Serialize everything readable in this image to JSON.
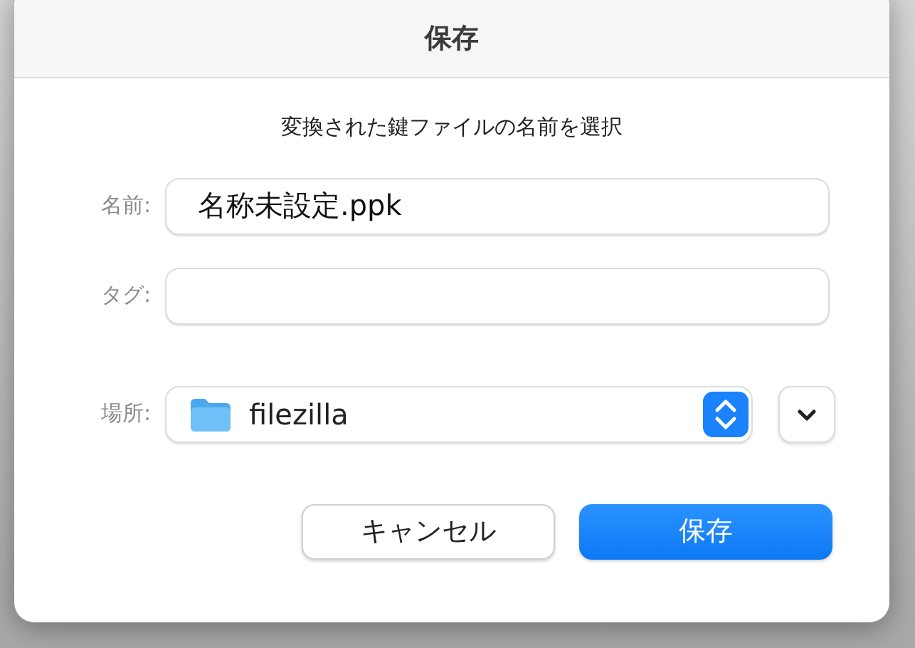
{
  "window": {
    "title": "保存"
  },
  "prompt": "変換された鍵ファイルの名前を選択",
  "fields": [
    {
      "label": "名前:",
      "value": "名称未設定.ppk"
    },
    {
      "label": "タグ:"
    }
  ],
  "location": {
    "label": "場所:",
    "value": "filezilla",
    "expanded": false
  },
  "buttons": [
    {
      "label": "キャンセル",
      "kind": "secondary"
    },
    {
      "label": "保存",
      "kind": "primary"
    }
  ]
}
